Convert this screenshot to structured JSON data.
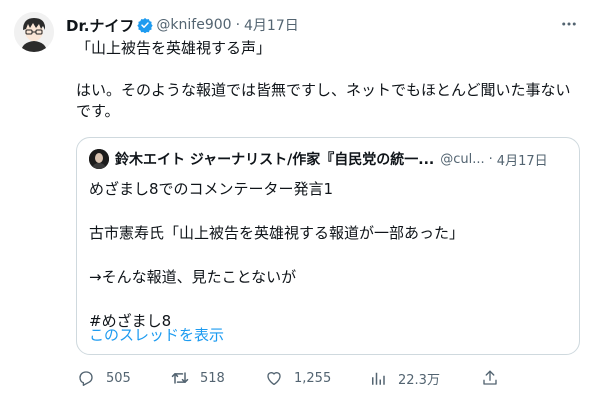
{
  "author": {
    "display_name": "Dr.ナイフ",
    "handle": "@knife900",
    "date": "4月17日",
    "separator": "·"
  },
  "tweet": {
    "text": "「山上被告を英雄視する声」\n\nはい。そのような報道では皆無ですし、ネットでもほとんど聞いた事ない\nです。"
  },
  "quoted": {
    "display_name": "鈴木エイト ジャーナリスト/作家『自民党の統一...",
    "handle": "@cul...",
    "separator": "·",
    "date": "4月17日",
    "lines": [
      "めざまし8でのコメンテーター発言1",
      "",
      "古市憲寿氏「山上被告を英雄視する報道が一部あった」",
      "",
      "→そんな報道、見たことないが",
      "",
      "#めざまし8"
    ],
    "show_thread_label": "このスレッドを表示"
  },
  "actions": {
    "reply_count": "505",
    "retweet_count": "518",
    "like_count": "1,255",
    "view_count": "22.3万"
  },
  "icons": {
    "verified": "verified-badge-icon",
    "more": "more-icon",
    "reply": "reply-icon",
    "retweet": "retweet-icon",
    "like": "heart-icon",
    "views": "views-chart-icon",
    "share": "share-icon"
  },
  "colors": {
    "accent": "#1d9bf0",
    "text": "#0f1419",
    "muted": "#536471",
    "border": "#cfd9de"
  }
}
